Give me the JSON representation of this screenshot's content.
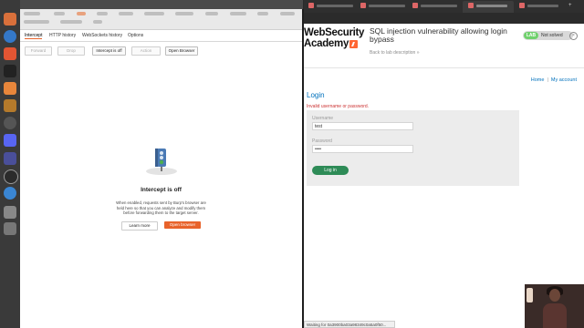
{
  "burp": {
    "subtabs": [
      "Intercept",
      "HTTP history",
      "WebSockets history",
      "Options"
    ],
    "toolbar": {
      "forward": "Forward",
      "drop": "Drop",
      "intercept_toggle": "Intercept is off",
      "action": "Action",
      "open_browser": "Open Browser"
    },
    "intercept_panel": {
      "title": "Intercept is off",
      "description": "When enabled, requests sent by Burp's browser are held here so that you can analyze and modify them before forwarding them to the target server.",
      "learn_more": "Learn more",
      "open_browser": "Open browser"
    }
  },
  "browser": {
    "status_text": "Waiting for 0a3900ba03a98349c0a5a0f50...",
    "site": {
      "logo_line1": "WebSecurity",
      "logo_line2": "Academy",
      "lab_title": "SQL injection vulnerability allowing login bypass",
      "back_link": "Back to lab description  »",
      "lab_badge": "LAB",
      "lab_status": "Not solved",
      "nav": {
        "home": "Home",
        "separator": "|",
        "account": "My account"
      },
      "heading": "Login",
      "error": "Invalid username or password.",
      "form": {
        "username_label": "Username",
        "username_value": "test",
        "password_label": "Password",
        "password_value": "••••",
        "submit": "Log in"
      }
    }
  },
  "colors": {
    "burp_accent": "#e8632b",
    "link_blue": "#0071bc",
    "error_red": "#cc3333",
    "login_green": "#2e8b57",
    "lab_green": "#70d16d"
  }
}
